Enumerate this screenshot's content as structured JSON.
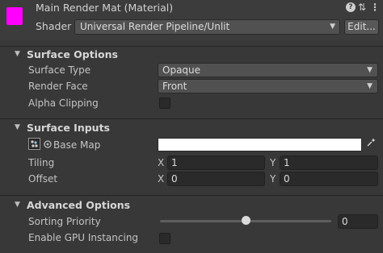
{
  "header": {
    "title": "Main Render Mat (Material)",
    "swatch_color": "#ff00ff",
    "help_icon": "help-icon",
    "settings_icon": "settings-icon",
    "menu_icon": "menu-icon",
    "shader_label": "Shader",
    "shader_value": "Universal Render Pipeline/Unlit",
    "edit_label": "Edit..."
  },
  "surface_options": {
    "title": "Surface Options",
    "surface_type_label": "Surface Type",
    "surface_type_value": "Opaque",
    "render_face_label": "Render Face",
    "render_face_value": "Front",
    "alpha_clipping_label": "Alpha Clipping",
    "alpha_clipping_checked": false
  },
  "surface_inputs": {
    "title": "Surface Inputs",
    "base_map_label": "Base Map",
    "base_map_color": "#ffffff",
    "tiling_label": "Tiling",
    "tiling_x": "1",
    "tiling_y": "1",
    "offset_label": "Offset",
    "offset_x": "0",
    "offset_y": "0",
    "x_label": "X",
    "y_label": "Y"
  },
  "advanced_options": {
    "title": "Advanced Options",
    "sorting_priority_label": "Sorting Priority",
    "sorting_priority_value": "0",
    "sorting_priority_slider_fraction": 0.5,
    "gpu_instancing_label": "Enable GPU Instancing",
    "gpu_instancing_checked": false
  }
}
